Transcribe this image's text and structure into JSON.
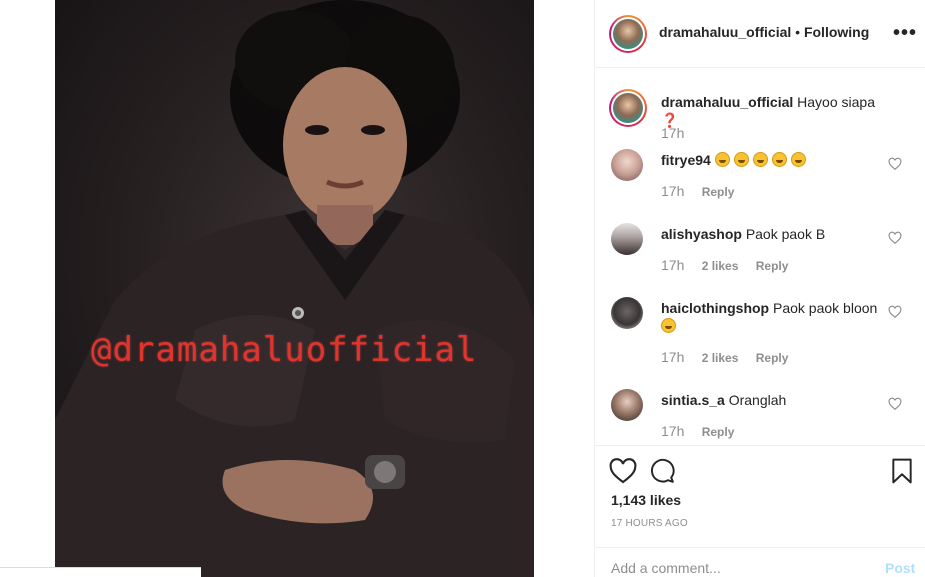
{
  "post": {
    "watermark": "@dramahaluofficial"
  },
  "header": {
    "username": "dramahaluu_official",
    "separator": "•",
    "follow_state": "Following",
    "more_icon": "more-horizontal-icon"
  },
  "comments": [
    {
      "username": "dramahaluu_official",
      "text": "Hayoo siapa",
      "time": "17h",
      "likes": "",
      "reply": "",
      "emoji": "question-mark"
    },
    {
      "username": "fitrye94",
      "text": "",
      "time": "17h",
      "likes": "",
      "reply": "Reply",
      "emoji": "grinning-x5"
    },
    {
      "username": "alishyashop",
      "text": "Paok paok B",
      "time": "17h",
      "likes": "2 likes",
      "reply": "Reply"
    },
    {
      "username": "haiclothingshop",
      "text": "Paok paok bloon",
      "time": "17h",
      "likes": "2 likes",
      "reply": "Reply",
      "emoji": "crying-laughing"
    },
    {
      "username": "sintia.s_a",
      "text": "Oranglah",
      "time": "17h",
      "likes": "",
      "reply": "Reply"
    }
  ],
  "actions": {
    "like_icon": "heart-icon",
    "comment_icon": "comment-icon",
    "save_icon": "bookmark-icon",
    "likes_count": "1,143 likes",
    "timestamp": "17 HOURS AGO"
  },
  "composer": {
    "placeholder": "Add a comment...",
    "post_label": "Post"
  },
  "colors": {
    "link_disabled": "#b2dffc",
    "muted": "#8e8e8e",
    "watermark": "#e0342d"
  }
}
